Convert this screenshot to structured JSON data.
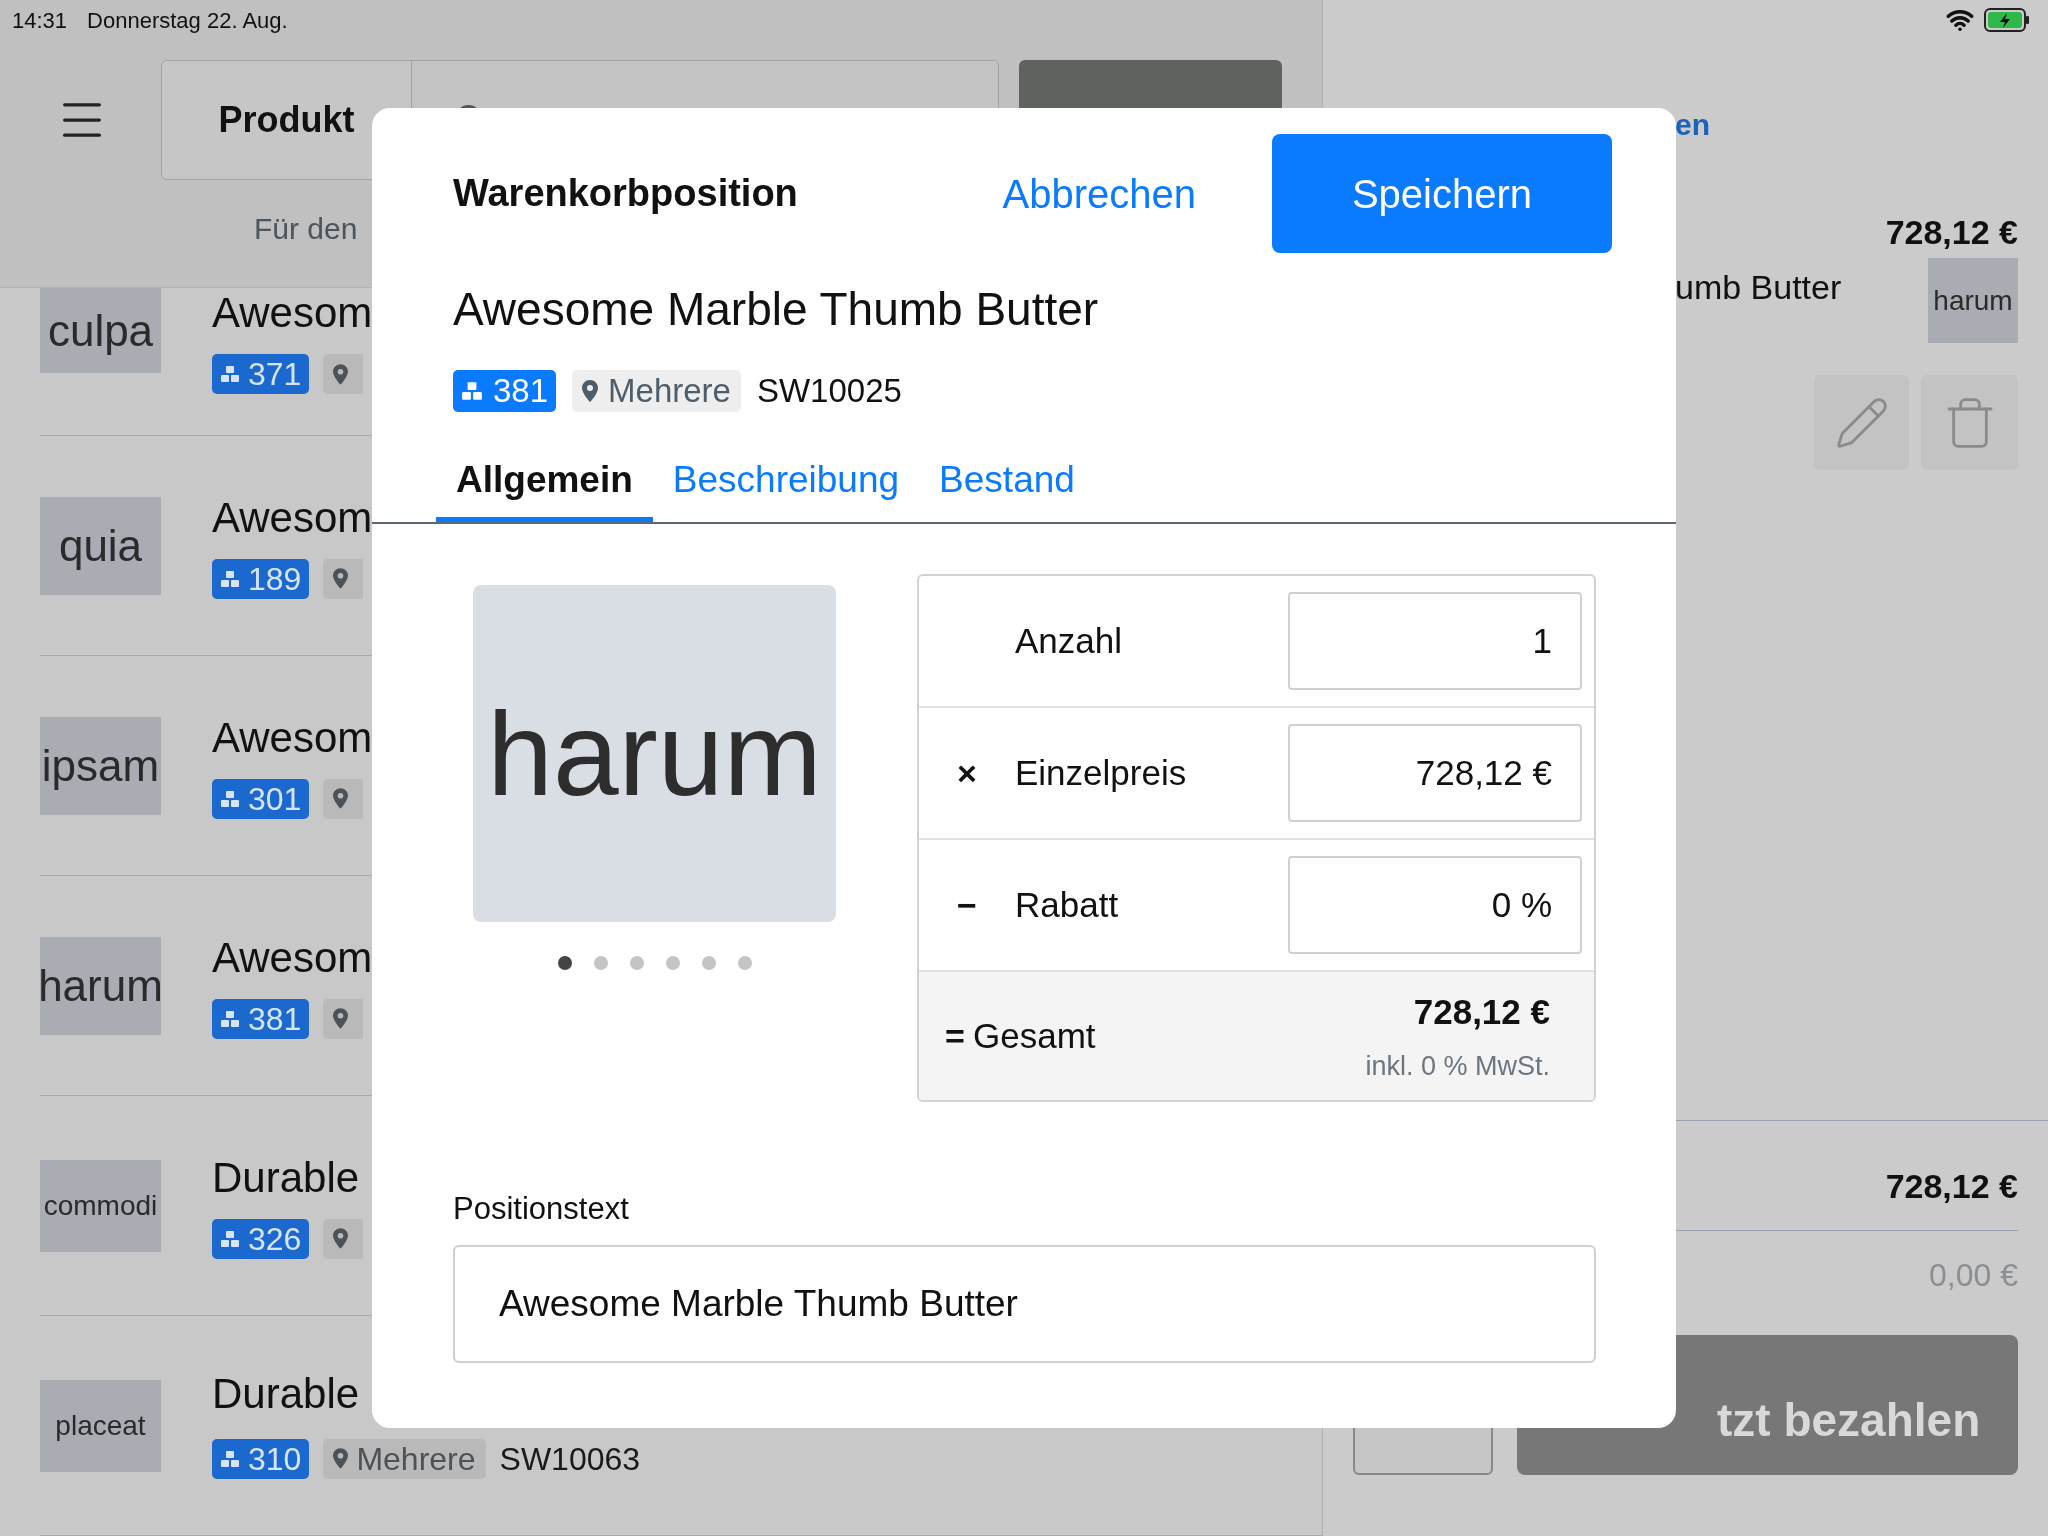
{
  "status_bar": {
    "time": "14:31",
    "date": "Donnerstag 22. Aug."
  },
  "toolbar": {
    "segment": "Produkt"
  },
  "list_hint": "Für den",
  "products": [
    {
      "thumb": "culpa",
      "title": "Awesom",
      "stock": "371"
    },
    {
      "thumb": "quia",
      "title": "Awesom",
      "stock": "189"
    },
    {
      "thumb": "ipsam",
      "title": "Awesom",
      "stock": "301"
    },
    {
      "thumb": "harum",
      "title": "Awesom",
      "stock": "381"
    },
    {
      "thumb": "commodi",
      "title": "Durable",
      "stock": "326"
    },
    {
      "thumb": "placeat",
      "title": "Durable",
      "stock": "310",
      "location": "Mehrere",
      "sku": "SW10063"
    }
  ],
  "cart": {
    "link": "en",
    "total_top": "728,12 €",
    "item_name": "umb Butter",
    "item_thumb": "harum",
    "subtotal": "728,12 €",
    "discount": "0,00 €",
    "pay_button": "tzt bezahlen"
  },
  "dialog": {
    "title": "Warenkorbposition",
    "cancel": "Abbrechen",
    "save": "Speichern",
    "product_name": "Awesome Marble Thumb Butter",
    "stock": "381",
    "location": "Mehrere",
    "sku": "SW10025",
    "tabs": [
      {
        "label": "Allgemein",
        "selected": true
      },
      {
        "label": "Beschreibung",
        "selected": false
      },
      {
        "label": "Bestand",
        "selected": false
      }
    ],
    "image_text": "harum",
    "image_dots": [
      {
        "selected": true
      },
      {
        "selected": false
      },
      {
        "selected": false
      },
      {
        "selected": false
      },
      {
        "selected": false
      },
      {
        "selected": false
      }
    ],
    "fields": [
      {
        "kind": "input",
        "label": "Anzahl",
        "value": "1"
      },
      {
        "kind": "input",
        "operator": "×",
        "label": "Einzelpreis",
        "value": "728,12 €"
      },
      {
        "kind": "input",
        "operator": "−",
        "label": "Rabatt",
        "value": "0 %"
      },
      {
        "kind": "total",
        "operator": "=",
        "label": "Gesamt",
        "value": "728,12 €",
        "note": "inkl. 0 % MwSt."
      }
    ],
    "note_label": "Positionstext",
    "note_value": "Awesome Marble Thumb Butter"
  }
}
